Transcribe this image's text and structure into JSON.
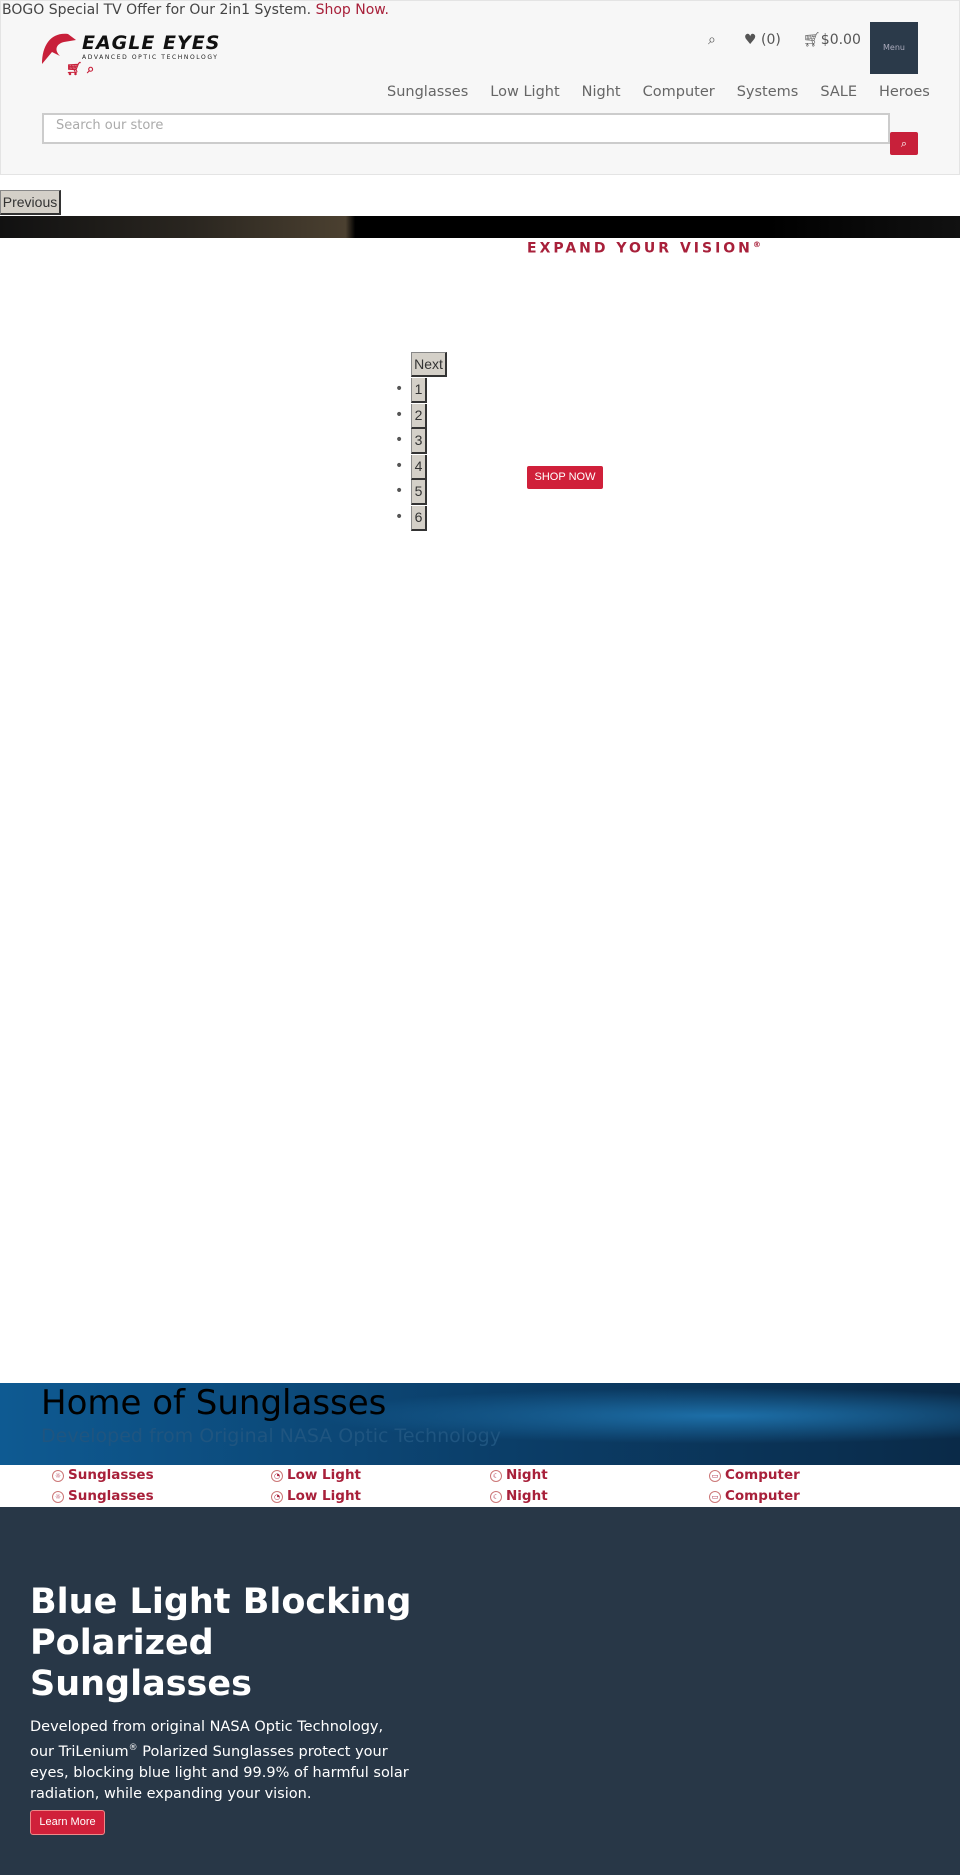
{
  "promo": {
    "text": "BOGO Special TV Offer for Our 2in1 System.",
    "link": "Shop Now."
  },
  "header": {
    "logo_text": "EAGLE EYES",
    "logo_sub": "ADVANCED OPTIC TECHNOLOGY",
    "wishlist": "(0)",
    "cart_total": "$0.00",
    "menu_label": "Menu"
  },
  "nav": [
    "Sunglasses",
    "Low Light",
    "Night",
    "Computer",
    "Systems",
    "SALE",
    "Heroes"
  ],
  "search": {
    "placeholder": "Search our store"
  },
  "slider": {
    "prev": "Previous",
    "next": "Next",
    "tagline": "EXPAND YOUR VISION",
    "tagline_mark": "®",
    "dots": [
      "1",
      "2",
      "3",
      "4",
      "5",
      "6"
    ],
    "cta": "SHOP NOW"
  },
  "hero": {
    "title": "Home of Sunglasses",
    "subtitle": "Developed from Original NASA Optic Technology"
  },
  "categories": {
    "row1": [
      "Sunglasses",
      "Low Light",
      "Night",
      "Computer"
    ],
    "row2": [
      "Sunglasses",
      "Low Light",
      "Night",
      "Computer"
    ]
  },
  "feature": {
    "title": "Blue Light Blocking Polarized Sunglasses",
    "p1": "Developed from original NASA Optic Technology, our TriLenium",
    "mark": "®",
    "p2": " Polarized Sunglasses protect your eyes, blocking blue light and 99.9% of harmful solar radiation, while expanding your vision.",
    "button": "Learn More"
  },
  "colors": {
    "brand_red": "#c8203a",
    "dark_navy": "#283747"
  }
}
